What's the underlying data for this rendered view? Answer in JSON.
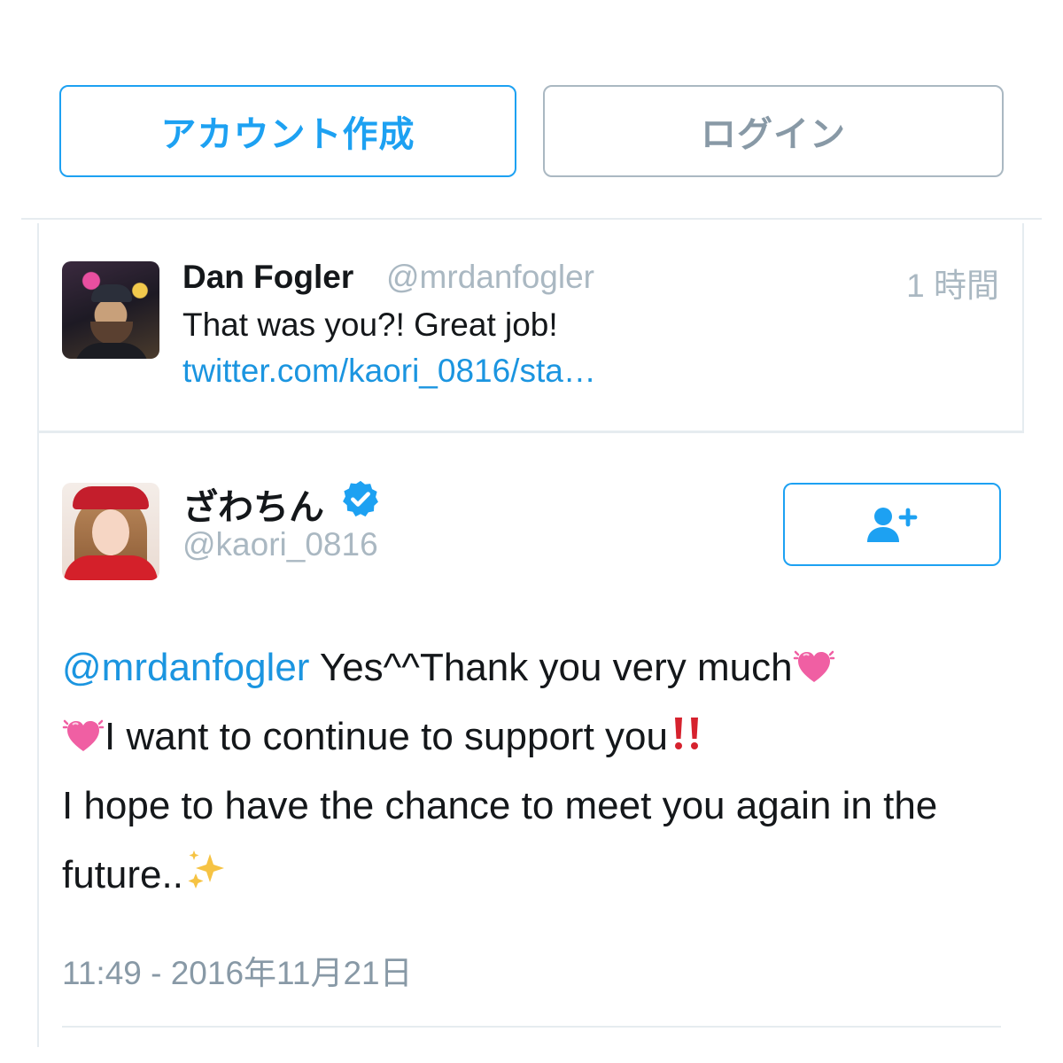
{
  "auth": {
    "signup_label": "アカウント作成",
    "login_label": "ログイン"
  },
  "reply_tweet": {
    "author_name": "Dan Fogler",
    "author_handle": "@mrdanfogler",
    "time": "1 時間",
    "text": "That was you?! Great job!",
    "link_text": "twitter.com/kaori_0816/sta…"
  },
  "main_tweet": {
    "author_name": "ざわちん",
    "verified": true,
    "author_handle": "@kaori_0816",
    "follow_icon": "add-user-icon",
    "mention": "@mrdanfogler",
    "text_part1": " Yes^^Thank you very much",
    "text_part2": "I want to continue to support you",
    "text_part3": "I hope to have the chance to meet you again in the future..",
    "emoji": [
      "heart-pulse-icon",
      "heart-pulse-icon",
      "double-exclamation-icon",
      "sparkles-icon"
    ],
    "timestamp": "11:49 - 2016年11月21日"
  },
  "colors": {
    "accent": "#1da1f2",
    "link": "#1b95e0",
    "muted": "#aab8c2",
    "text": "#14171a",
    "divider": "#e6ecf0"
  }
}
